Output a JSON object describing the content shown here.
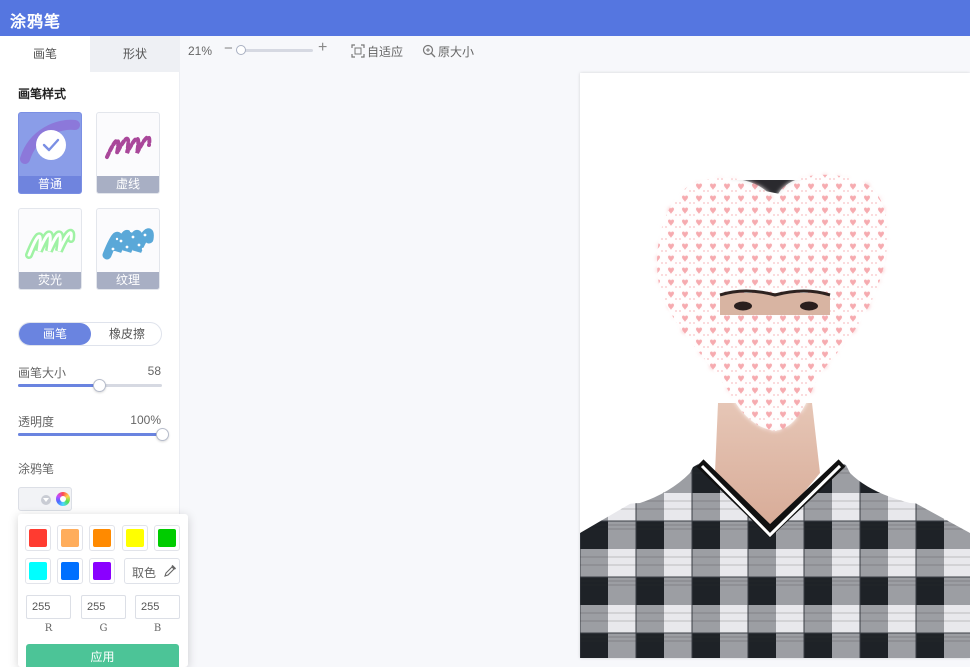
{
  "app": {
    "title": "涂鸦笔"
  },
  "tabs": [
    {
      "label": "画笔"
    },
    {
      "label": "形状"
    }
  ],
  "brush_style": {
    "title": "画笔样式",
    "items": [
      {
        "label": "普通",
        "selected": true
      },
      {
        "label": "虚线",
        "selected": false
      },
      {
        "label": "荧光",
        "selected": false
      },
      {
        "label": "纹理",
        "selected": false
      }
    ]
  },
  "mode": {
    "brush": "画笔",
    "eraser": "橡皮擦",
    "selected": "画笔"
  },
  "brush_size": {
    "label": "画笔大小",
    "value": "58",
    "fraction": 0.56
  },
  "opacity": {
    "label": "透明度",
    "value": "100%",
    "fraction": 1.0
  },
  "pen": {
    "label": "涂鸦笔"
  },
  "palette": {
    "colors": [
      "#ff3b30",
      "#ffad5b",
      "#ff8a00",
      "#ffff00",
      "#00cc00",
      "#00ffff",
      "#0070ff",
      "#8a00ff"
    ],
    "pick_label": "取色",
    "r": "255",
    "g": "255",
    "b": "255",
    "r_label": "R",
    "g_label": "G",
    "b_label": "B",
    "apply_label": "应用"
  },
  "toolbar": {
    "zoom": "21%",
    "zoom_fraction": 0.0,
    "fit_label": "自适应",
    "original_label": "原大小"
  },
  "canvas": {
    "background": "#ffffff",
    "heart_pattern_color": "#f5a3a8",
    "shirt_dark": "#1e2227",
    "shirt_light": "#e8e8ec"
  }
}
